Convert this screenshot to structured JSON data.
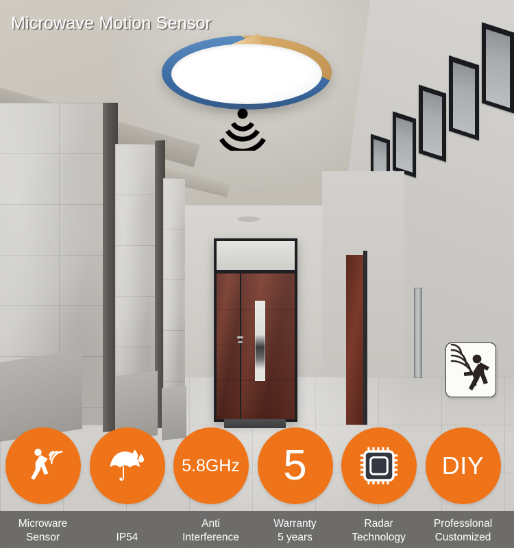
{
  "poster": {
    "title": "Microwave Motion Sensor",
    "brand_orange": "#ef7318",
    "label_bar_color": "#605f5c",
    "lamp": {
      "rim_color": "#3f6ea6",
      "wood_color": "#d7a968",
      "diffuser_color": "#ffffff",
      "emitted_signal_icon": "radar-waves-icon"
    },
    "sensor_badge": {
      "icon": "motion-sensor-walking-person-icon"
    }
  },
  "features": [
    {
      "icon": "walking-person-radar-icon",
      "circle_text": "",
      "label_line1": "Microware",
      "label_line2": "Sensor"
    },
    {
      "icon": "umbrella-raindrops-icon",
      "circle_text": "",
      "label_line1": "IP54",
      "label_line2": ""
    },
    {
      "icon": "",
      "circle_text": "5.8GHz",
      "label_line1": "Anti",
      "label_line2": "Interference"
    },
    {
      "icon": "",
      "circle_text": "5",
      "label_line1": "Warranty",
      "label_line2": "5 years"
    },
    {
      "icon": "microchip-icon",
      "circle_text": "",
      "label_line1": "Radar",
      "label_line2": "Technology"
    },
    {
      "icon": "",
      "circle_text": "DIY",
      "label_line1": "Professlonal",
      "label_line2": "Customized"
    }
  ]
}
